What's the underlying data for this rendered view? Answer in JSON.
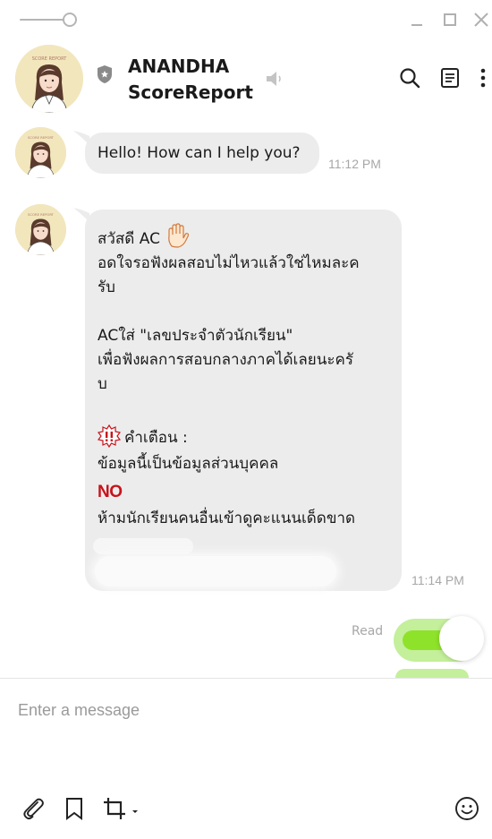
{
  "chat": {
    "name": "ANANDHA",
    "subtitle": "ScoreReport"
  },
  "avatar": {
    "logo_text": "SCORE REPORT"
  },
  "messages": [
    {
      "sender": "bot",
      "lines": [
        "Hello! How can I help you?"
      ],
      "time": "11:12 PM"
    },
    {
      "sender": "bot",
      "greeting": "สวัสดี AC",
      "lines": [
        "อดใจรอฟังผลสอบไม่ไหวแล้วใช่ไหมละค",
        "รับ",
        "ACใส่ \"เลขประจำตัวนักเรียน\"",
        "เพื่อฟังผลการสอบกลางภาคได้เลยนะครั",
        "บ",
        "คำเตือน :",
        "ข้อมูลนี้เป็นข้อมูลส่วนบุคคล",
        "NO",
        "ห้ามนักเรียนคนอื่นเข้าดูคะแนนเด็ดขาด"
      ],
      "time": "11:14 PM"
    }
  ],
  "outgoing": {
    "status": "Read"
  },
  "composer": {
    "placeholder": "Enter a message"
  },
  "icons": {
    "pin": "pin-toggle-icon",
    "minimize": "minimize-icon",
    "maximize": "maximize-icon",
    "close": "close-icon",
    "shield": "shield-icon",
    "speaker": "speaker-muted-icon",
    "search": "search-icon",
    "notes": "notes-icon",
    "more": "more-vertical-icon",
    "attach": "paperclip-icon",
    "bookmark": "bookmark-icon",
    "crop": "crop-icon",
    "emoji": "emoji-icon",
    "wave": "raised-hand-emoji",
    "warning": "bang-bang-emoji"
  },
  "colors": {
    "bubble": "#ececec",
    "outgoing": "#c4ef9b",
    "warning_red": "#c8121a"
  }
}
